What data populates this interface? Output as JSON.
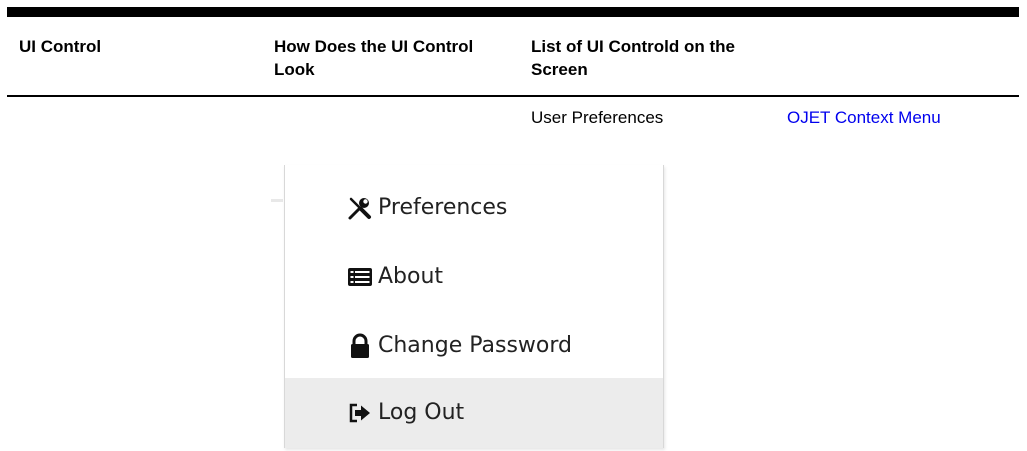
{
  "table": {
    "headers": [
      "UI Control",
      "How Does the UI Control Look",
      "List of UI Controld on the Screen"
    ],
    "row": {
      "list_item": "User Preferences",
      "link": "OJET Context Menu"
    }
  },
  "context_menu": {
    "items": [
      {
        "label": "Preferences",
        "icon": "tools-icon"
      },
      {
        "label": "About",
        "icon": "list-icon"
      },
      {
        "label": "Change Password",
        "icon": "lock-icon"
      },
      {
        "label": "Log Out",
        "icon": "sign-out-icon",
        "highlighted": true
      }
    ],
    "highlight_color": "#ececec"
  },
  "colors": {
    "link": "#0000ee",
    "rule": "#000000"
  }
}
